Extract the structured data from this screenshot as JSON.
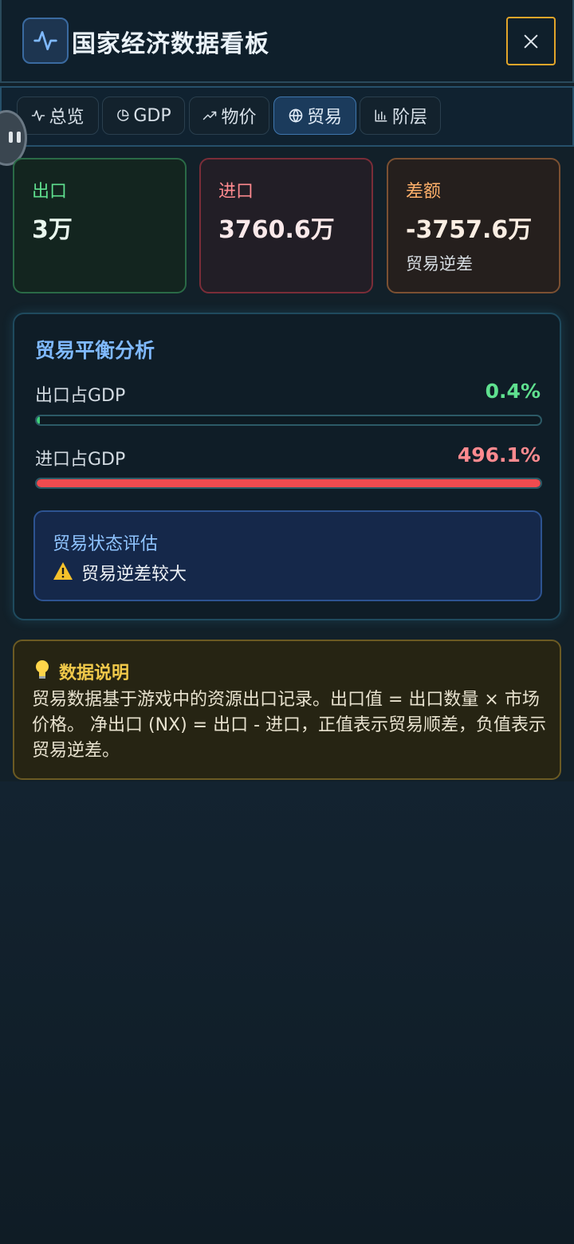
{
  "header": {
    "title": "国家经济数据看板",
    "close_icon": "close-icon",
    "logo_icon": "activity-icon"
  },
  "tabs": [
    {
      "label": "总览",
      "icon": "activity-icon",
      "active": false
    },
    {
      "label": "GDP",
      "icon": "pie-chart-icon",
      "active": false
    },
    {
      "label": "物价",
      "icon": "trending-up-icon",
      "active": false
    },
    {
      "label": "贸易",
      "icon": "globe-icon",
      "active": true
    },
    {
      "label": "阶层",
      "icon": "bar-chart-icon",
      "active": false
    }
  ],
  "cards": {
    "export": {
      "label": "出口",
      "value": "3万"
    },
    "import": {
      "label": "进口",
      "value": "3760.6万"
    },
    "balance": {
      "label": "差额",
      "value": "-3757.6万",
      "note": "贸易逆差"
    }
  },
  "analysis": {
    "title": "贸易平衡分析",
    "export_ratio": {
      "label": "出口占GDP",
      "value": "0.4%",
      "percent": 0.4,
      "color": "#5fe08f"
    },
    "import_ratio": {
      "label": "进口占GDP",
      "value": "496.1%",
      "percent": 100,
      "color": "#ff8a8f"
    },
    "status": {
      "title": "贸易状态评估",
      "text": "贸易逆差较大",
      "icon": "warning-icon"
    }
  },
  "note": {
    "title": "数据说明",
    "icon": "lightbulb-icon",
    "body": "贸易数据基于游戏中的资源出口记录。出口值 = 出口数量 × 市场价格。 净出口 (NX) = 出口 - 进口，正值表示贸易顺差，负值表示贸易逆差。"
  },
  "colors": {
    "accent": "#7fb9ff",
    "positive": "#5fe08f",
    "negative": "#ff8a8f",
    "warning": "#f0c94a"
  }
}
